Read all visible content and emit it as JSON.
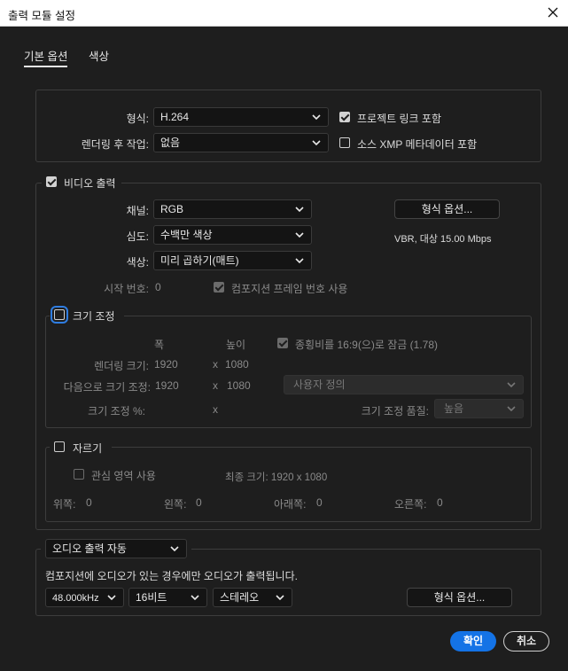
{
  "window": {
    "title": "출력 모듈 설정"
  },
  "tabs": [
    {
      "label": "기본 옵션",
      "active": true
    },
    {
      "label": "색상",
      "active": false
    }
  ],
  "format_section": {
    "format_label": "형식:",
    "format_value": "H.264",
    "post_render_label": "렌더링 후 작업:",
    "post_render_value": "없음",
    "project_link_label": "프로젝트 링크 포함",
    "project_link_checked": true,
    "xmp_label": "소스 XMP 메타데이터 포함",
    "xmp_checked": false
  },
  "video": {
    "title": "비디오 출력",
    "checked": true,
    "channel_label": "채널:",
    "channel_value": "RGB",
    "depth_label": "심도:",
    "depth_value": "수백만 색상",
    "color_label": "색상:",
    "color_value": "미리 곱하기(매트)",
    "format_options_button": "형식 옵션...",
    "bitrate_info": "VBR, 대상 15.00 Mbps",
    "start_number_label": "시작 번호:",
    "start_number_value": "0",
    "use_comp_frame_label": "컴포지션 프레임 번호 사용",
    "use_comp_frame_checked": true
  },
  "resize": {
    "title": "크기 조정",
    "checked": false,
    "width_header": "폭",
    "height_header": "높이",
    "aspect_lock_label": "종횡비를 16:9(으)로 잠금 (1.78)",
    "aspect_lock_checked": true,
    "render_size_label": "렌더링 크기:",
    "render_w": "1920",
    "render_x": "x",
    "render_h": "1080",
    "resize_to_label": "다음으로 크기 조정:",
    "resize_w": "1920",
    "resize_x": "x",
    "resize_h": "1080",
    "preset_value": "사용자 정의",
    "resize_pct_label": "크기 조정 %:",
    "resize_pct_x": "x",
    "quality_label": "크기 조정 품질:",
    "quality_value": "높음"
  },
  "crop": {
    "title": "자르기",
    "checked": false,
    "roi_label": "관심 영역 사용",
    "roi_checked": false,
    "final_size_label": "최종 크기:",
    "final_size_value": "1920 x 1080",
    "top_label": "위쪽:",
    "top_value": "0",
    "left_label": "왼쪽:",
    "left_value": "0",
    "bottom_label": "아래쪽:",
    "bottom_value": "0",
    "right_label": "오른쪽:",
    "right_value": "0"
  },
  "audio": {
    "mode_value": "오디오 출력 자동",
    "info": "컴포지션에 오디오가 있는 경우에만 오디오가 출력됩니다.",
    "rate_value": "48.000kHz",
    "bits_value": "16비트",
    "channels_value": "스테레오",
    "format_options_button": "형식 옵션..."
  },
  "footer": {
    "ok": "확인",
    "cancel": "취소"
  },
  "colors": {
    "accent": "#1473e6",
    "background": "#1e1e1e"
  }
}
